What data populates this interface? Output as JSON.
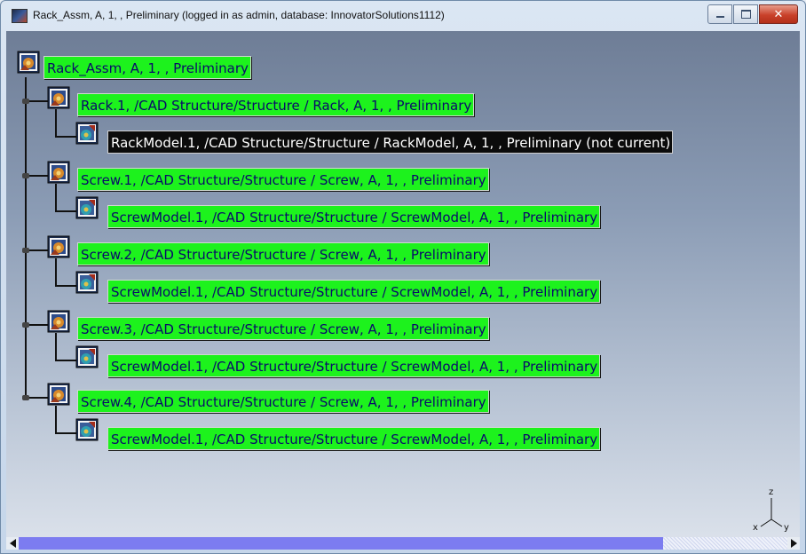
{
  "window": {
    "title": "Rack_Assm, A, 1, , Preliminary (logged in as admin, database: InnovatorSolutions1112)",
    "controls": [
      "minimize-icon",
      "maximize-icon",
      "close-icon"
    ]
  },
  "tree": {
    "root": {
      "label": "Rack_Assm, A, 1, , Preliminary",
      "icon": "product-icon",
      "status": "green"
    },
    "children": [
      {
        "label": "Rack.1, /CAD Structure/Structure / Rack, A, 1, , Preliminary",
        "icon": "product-icon",
        "status": "green",
        "child": {
          "label": "RackModel.1, /CAD Structure/Structure / RackModel, A, 1, , Preliminary (not current)",
          "icon": "part-icon",
          "status": "black"
        }
      },
      {
        "label": "Screw.1, /CAD Structure/Structure / Screw, A, 1, , Preliminary",
        "icon": "product-icon",
        "status": "green",
        "child": {
          "label": "ScrewModel.1, /CAD Structure/Structure / ScrewModel, A, 1, , Preliminary",
          "icon": "part-icon",
          "status": "green"
        }
      },
      {
        "label": "Screw.2, /CAD Structure/Structure / Screw, A, 1, , Preliminary",
        "icon": "product-icon",
        "status": "green",
        "child": {
          "label": "ScrewModel.1, /CAD Structure/Structure / ScrewModel, A, 1, , Preliminary",
          "icon": "part-icon",
          "status": "green"
        }
      },
      {
        "label": "Screw.3, /CAD Structure/Structure / Screw, A, 1, , Preliminary",
        "icon": "product-icon",
        "status": "green",
        "child": {
          "label": "ScrewModel.1, /CAD Structure/Structure / ScrewModel, A, 1, , Preliminary",
          "icon": "part-icon",
          "status": "green"
        }
      },
      {
        "label": "Screw.4, /CAD Structure/Structure / Screw, A, 1, , Preliminary",
        "icon": "product-icon",
        "status": "green",
        "child": {
          "label": "ScrewModel.1, /CAD Structure/Structure / ScrewModel, A, 1, , Preliminary",
          "icon": "part-icon",
          "status": "green"
        }
      }
    ]
  },
  "axis": {
    "z": "z",
    "x": "x",
    "y": "y"
  },
  "colors": {
    "status_green": "#1df21d",
    "status_black": "#0b0b0b",
    "label_text": "#0a0a6a"
  }
}
